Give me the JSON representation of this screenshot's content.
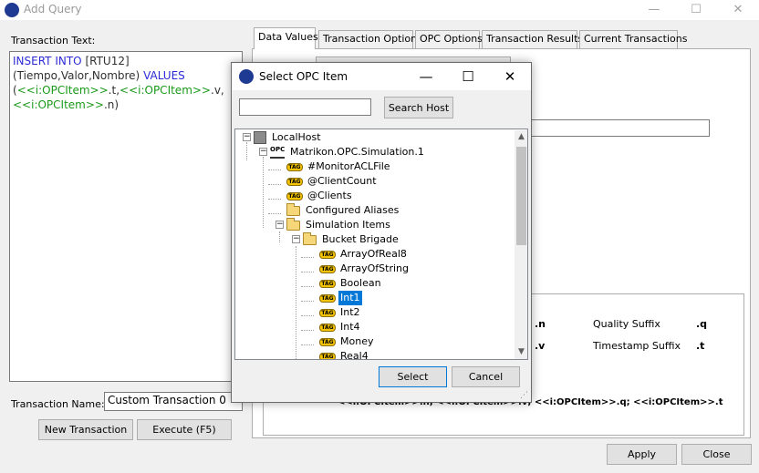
{
  "window": {
    "title": "Add Query",
    "minimize_glyph": "—",
    "maximize_glyph": "☐",
    "close_glyph": "✕"
  },
  "left_panel": {
    "transaction_text_label": "Transaction Text:",
    "sql": {
      "kw1": "INSERT INTO",
      "t1": " [RTU12]",
      "t2": "(Tiempo,Valor,Nombre) ",
      "kw2": "VALUES",
      "t3": "(",
      "tag1": "<<i:OPCItem>>",
      "t4": ".t,",
      "tag2": "<<i:OPCItem>>",
      "t5": ".v,",
      "tag3": "<<i:OPCItem>>",
      "t6": ".n)"
    },
    "transaction_name_label": "Transaction Name:",
    "transaction_name_value": "Custom Transaction 0",
    "new_transaction_button": "New Transaction",
    "execute_button": "Execute (F5)"
  },
  "tabs": [
    {
      "label": "Data Values",
      "active": true
    },
    {
      "label": "Transaction Options"
    },
    {
      "label": "OPC Options"
    },
    {
      "label": "Transaction Results"
    },
    {
      "label": "Current Transactions"
    }
  ],
  "suffixes": {
    "partial_value_1": ".n",
    "partial_value_2": ".v",
    "quality_label": "Quality Suffix",
    "quality_value": ".q",
    "timestamp_label": "Timestamp Suffix",
    "timestamp_value": ".t",
    "summary": "<<i:OPCItem>>.n; <<i:OPCItem>>.v; <<i:OPCItem>>.q; <<i:OPCItem>>.t"
  },
  "footer": {
    "apply_button": "Apply",
    "close_button": "Close"
  },
  "dialog": {
    "title": "Select OPC Item",
    "minimize_glyph": "—",
    "maximize_glyph": "☐",
    "close_glyph": "✕",
    "search_value": "",
    "search_button": "Search Host",
    "select_button": "Select",
    "cancel_button": "Cancel",
    "tree": [
      {
        "label": "LocalHost",
        "icon": "host-icon"
      },
      {
        "label": "Matrikon.OPC.Simulation.1",
        "icon": "opc-server-icon",
        "icon_text": "OPC"
      },
      {
        "label": "#MonitorACLFile",
        "icon": "tag-icon"
      },
      {
        "label": "@ClientCount",
        "icon": "tag-icon"
      },
      {
        "label": "@Clients",
        "icon": "tag-icon"
      },
      {
        "label": "Configured Aliases",
        "icon": "folder-icon"
      },
      {
        "label": "Simulation Items",
        "icon": "folder-icon"
      },
      {
        "label": "Bucket Brigade",
        "icon": "folder-icon"
      },
      {
        "label": "ArrayOfReal8",
        "icon": "tag-icon"
      },
      {
        "label": "ArrayOfString",
        "icon": "tag-icon"
      },
      {
        "label": "Boolean",
        "icon": "tag-icon"
      },
      {
        "label": "Int1",
        "icon": "tag-icon",
        "selected": true
      },
      {
        "label": "Int2",
        "icon": "tag-icon"
      },
      {
        "label": "Int4",
        "icon": "tag-icon"
      },
      {
        "label": "Money",
        "icon": "tag-icon"
      },
      {
        "label": "Real4",
        "icon": "tag-icon"
      }
    ],
    "tag_icon_text": "TAG",
    "expander_minus": "−",
    "scroll_up": "▲",
    "scroll_down": "▼",
    "grip_glyph": "⋰"
  }
}
